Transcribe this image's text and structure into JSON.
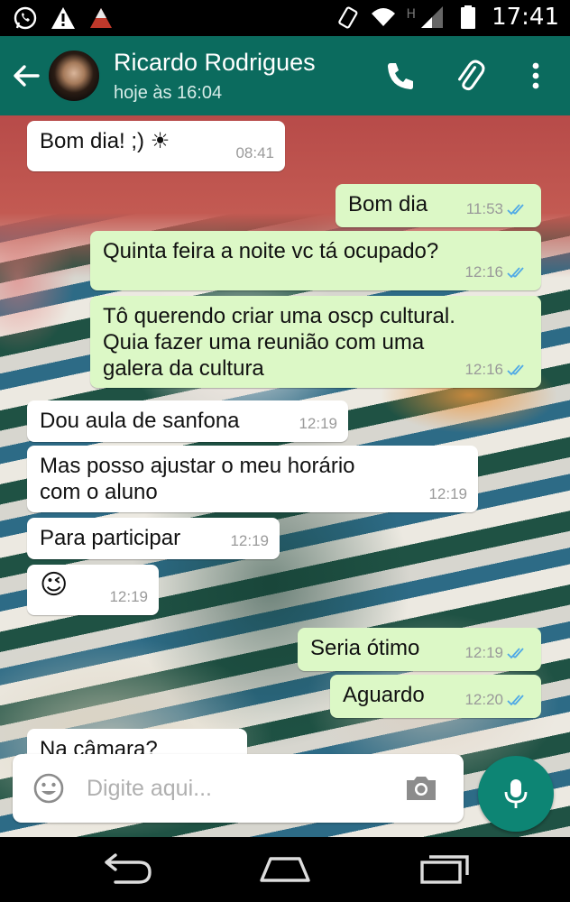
{
  "status_bar": {
    "time": "17:41",
    "network_letter": "H",
    "icons": [
      "whatsapp-notification-icon",
      "warning-icon",
      "alert-icon",
      "vibrate-icon",
      "wifi-icon",
      "signal-icon",
      "battery-icon"
    ]
  },
  "header": {
    "contact_name": "Ricardo Rodrigues",
    "last_seen": "hoje às 16:04",
    "background_color": "#0b6b5e",
    "icons": [
      "back-arrow-icon",
      "phone-icon",
      "paperclip-icon",
      "more-vert-icon"
    ]
  },
  "messages": [
    {
      "direction": "in",
      "text": "Bom dia!  ;) ☀",
      "time": "08:41"
    },
    {
      "direction": "out",
      "text": "Bom dia",
      "time": "11:53",
      "read": true
    },
    {
      "direction": "out",
      "text": "Quinta feira a noite vc tá ocupado?",
      "time": "12:16",
      "read": true
    },
    {
      "direction": "out",
      "text": "Tô querendo criar uma oscp cultural.\nQuia fazer uma reunião com uma\ngalera da cultura",
      "time": "12:16",
      "read": true
    },
    {
      "direction": "in",
      "text": "Dou aula de sanfona",
      "time": "12:19"
    },
    {
      "direction": "in",
      "text": "Mas posso ajustar o meu horário\ncom o aluno",
      "time": "12:19"
    },
    {
      "direction": "in",
      "text": "Para participar",
      "time": "12:19"
    },
    {
      "direction": "in",
      "text": "😉",
      "time": "12:19"
    },
    {
      "direction": "out",
      "text": "Seria ótimo",
      "time": "12:19",
      "read": true
    },
    {
      "direction": "out",
      "text": "Aguardo",
      "time": "12:20",
      "read": true
    },
    {
      "direction": "in",
      "text": "Na câmara?",
      "time": ""
    }
  ],
  "input": {
    "placeholder": "Digite aqui...",
    "value": ""
  },
  "colors": {
    "incoming_bubble": "#ffffff",
    "outgoing_bubble": "#dcf8c6",
    "read_ticks": "#4fa9e6",
    "mic_button": "#0d8574"
  }
}
